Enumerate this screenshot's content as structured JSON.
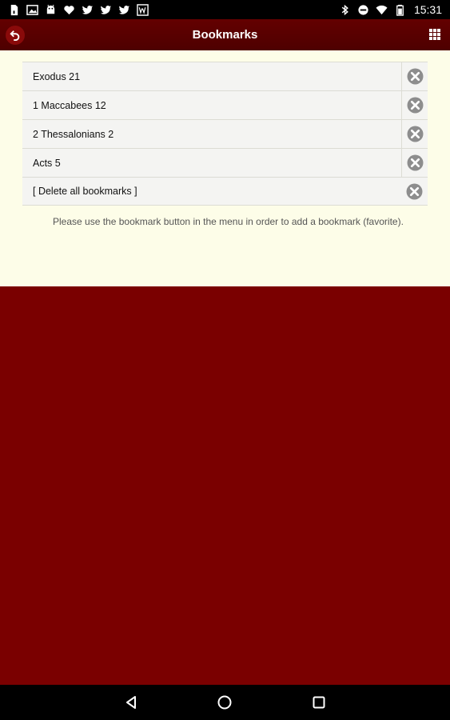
{
  "status_bar": {
    "time": "15:31",
    "left_icons": [
      "sim-card-icon",
      "image-icon",
      "android-icon",
      "heart-icon",
      "twitter-icon",
      "twitter-icon",
      "twitter-icon",
      "w-app-icon"
    ],
    "right_icons": [
      "bluetooth-icon",
      "do-not-disturb-icon",
      "wifi-icon",
      "battery-icon"
    ]
  },
  "app_bar": {
    "title": "Bookmarks",
    "back_icon": "back-icon",
    "menu_icon": "grid-menu-icon"
  },
  "bookmarks": [
    {
      "label": "Exodus 21"
    },
    {
      "label": "1 Maccabees 12"
    },
    {
      "label": "2 Thessalonians 2"
    },
    {
      "label": "Acts 5"
    }
  ],
  "delete_all": {
    "label": "[ Delete all bookmarks ]"
  },
  "hint": "Please use the bookmark button in the menu in order to add a bookmark (favorite).",
  "nav_bar": {
    "icons": [
      "back-triangle-icon",
      "home-circle-icon",
      "recents-square-icon"
    ]
  },
  "colors": {
    "app_bar": "#5a0000",
    "background": "#7a0000",
    "content": "#fdfde8",
    "row": "#f4f4f2"
  }
}
